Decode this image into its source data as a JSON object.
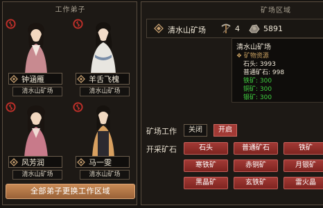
{
  "left_panel": {
    "title": "工作弟子",
    "disciples": [
      {
        "name": "钟涵雁",
        "mine": "清水山矿场",
        "hair": "#1a1410",
        "robe": "#c88a90"
      },
      {
        "name": "羊舌飞槐",
        "mine": "清水山矿场",
        "hair": "#16120e",
        "robe": "#e8e6e0"
      },
      {
        "name": "风芳润",
        "mine": "清水山矿场",
        "hair": "#1a1410",
        "robe": "#c87a8a"
      },
      {
        "name": "马一雯",
        "mine": "清水山矿场",
        "hair": "#16120e",
        "robe": "#d8a060"
      }
    ],
    "swap_all_label": "全部弟子更换工作区域"
  },
  "right_panel": {
    "title": "矿场区域",
    "mine_name": "清水山矿场",
    "pickaxe_count": "4",
    "ore_count": "5891",
    "tooltip": {
      "title": "清水山矿场",
      "subtitle": "❖ 矿物资源",
      "lines": [
        {
          "text": "石头: 3993",
          "color": "#f0e8d8"
        },
        {
          "text": "普通矿石: 998",
          "color": "#f0e8d8"
        },
        {
          "text": "铁矿: 300",
          "color": "#40d040"
        },
        {
          "text": "铜矿: 300",
          "color": "#40d040"
        },
        {
          "text": "银矿: 300",
          "color": "#40d040"
        }
      ]
    },
    "work_label": "矿场工作",
    "off_label": "关闭",
    "on_label": "开启",
    "ore_label": "开采矿石",
    "ores": [
      "石头",
      "普通矿石",
      "铁矿",
      "寒铁矿",
      "赤铜矿",
      "月银矿",
      "黑晶矿",
      "玄铁矿",
      "雷火晶"
    ]
  },
  "colors": {
    "accent_red": "#a23a35",
    "green": "#40d040",
    "gold": "#c88a55"
  }
}
